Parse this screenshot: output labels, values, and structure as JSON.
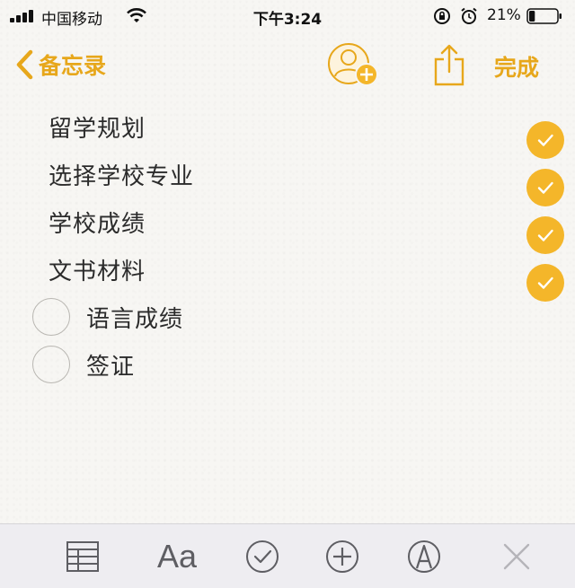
{
  "status_bar": {
    "carrier": "中国移动",
    "time": "下午3:24",
    "battery_percent": "21%",
    "battery_level": 0.21
  },
  "nav": {
    "back_label": "备忘录",
    "done_label": "完成"
  },
  "checklist": [
    {
      "text": "留学规划",
      "checked": true
    },
    {
      "text": "选择学校专业",
      "checked": true
    },
    {
      "text": "学校成绩",
      "checked": true
    },
    {
      "text": "文书材料",
      "checked": true
    },
    {
      "text": "语言成绩",
      "checked": false
    },
    {
      "text": "签证",
      "checked": false
    }
  ],
  "toolbar": {
    "format_label": "Aa",
    "icons": [
      "table-icon",
      "format-text-icon",
      "checklist-icon",
      "add-icon",
      "markup-icon",
      "close-icon"
    ]
  },
  "colors": {
    "accent": "#e7a71b",
    "check_fill": "#f4b62a",
    "toolbar_icon": "#5e5e63"
  }
}
